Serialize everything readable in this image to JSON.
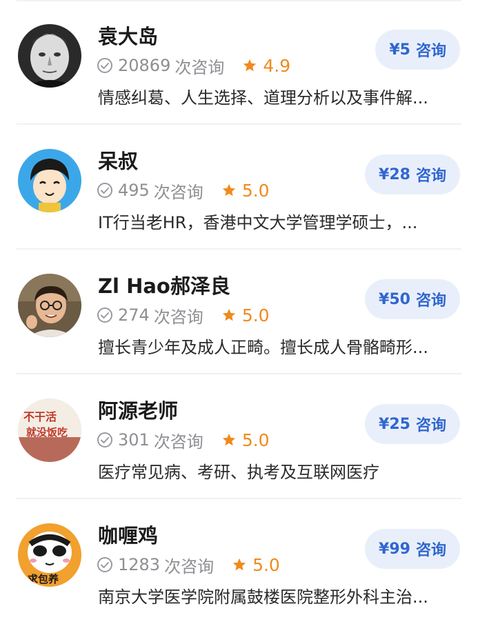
{
  "list": {
    "count_unit": "次咨询",
    "consult_label": "咨询",
    "items": [
      {
        "name": "袁大岛",
        "count": "20869",
        "rating": "4.9",
        "price": "¥5",
        "desc": "情感纠葛、人生选择、道理分析以及事件解...",
        "avatar": "portrait-black-white"
      },
      {
        "name": "呆叔",
        "count": "495",
        "rating": "5.0",
        "price": "¥28",
        "desc": "IT行当老HR，香港中文大学管理学硕士，...",
        "avatar": "cartoon-boy"
      },
      {
        "name": "Zl Hao郝泽良",
        "count": "274",
        "rating": "5.0",
        "price": "¥50",
        "desc": "擅长青少年及成人正畸。擅长成人骨骼畸形...",
        "avatar": "photo-man-glasses"
      },
      {
        "name": "阿源老师",
        "count": "301",
        "rating": "5.0",
        "price": "¥25",
        "desc": "医疗常见病、考研、执考及互联网医疗",
        "avatar": "sign-photo",
        "avatar_text": [
          "不干活",
          "就没饭吃"
        ]
      },
      {
        "name": "咖喱鸡",
        "count": "1283",
        "rating": "5.0",
        "price": "¥99",
        "desc": "南京大学医学院附属鼓楼医院整形外科主治...",
        "avatar": "panda-sticker",
        "avatar_text": "求包养"
      }
    ]
  },
  "colors": {
    "accent": "#2f66d0",
    "button_bg": "#e9effa",
    "rating": "#f08a1c",
    "muted": "#8e8e93"
  }
}
